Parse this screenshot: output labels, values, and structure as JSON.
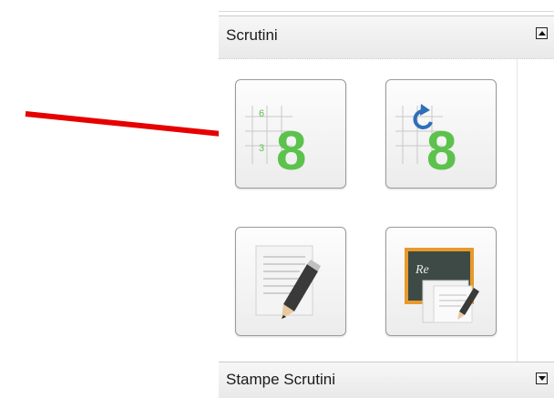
{
  "panel": {
    "sections": [
      {
        "title": "Scrutini",
        "collapse_icon": "collapse-up-icon"
      },
      {
        "title": "Stampe Scrutini",
        "collapse_icon": "expand-down-icon"
      }
    ],
    "tiles": [
      {
        "name": "grades-grid-icon",
        "small_digit_top": "6",
        "small_digit_bottom": "3",
        "big_digit": "8"
      },
      {
        "name": "refresh-grades-icon",
        "big_digit": "8"
      },
      {
        "name": "notes-pencil-icon"
      },
      {
        "name": "blackboard-report-icon",
        "board_text": "Re"
      }
    ]
  },
  "colors": {
    "arrow": "#e60000",
    "green": "#5cc24c",
    "refresh_blue": "#2f6fb8",
    "board_frame": "#e89a2c"
  }
}
